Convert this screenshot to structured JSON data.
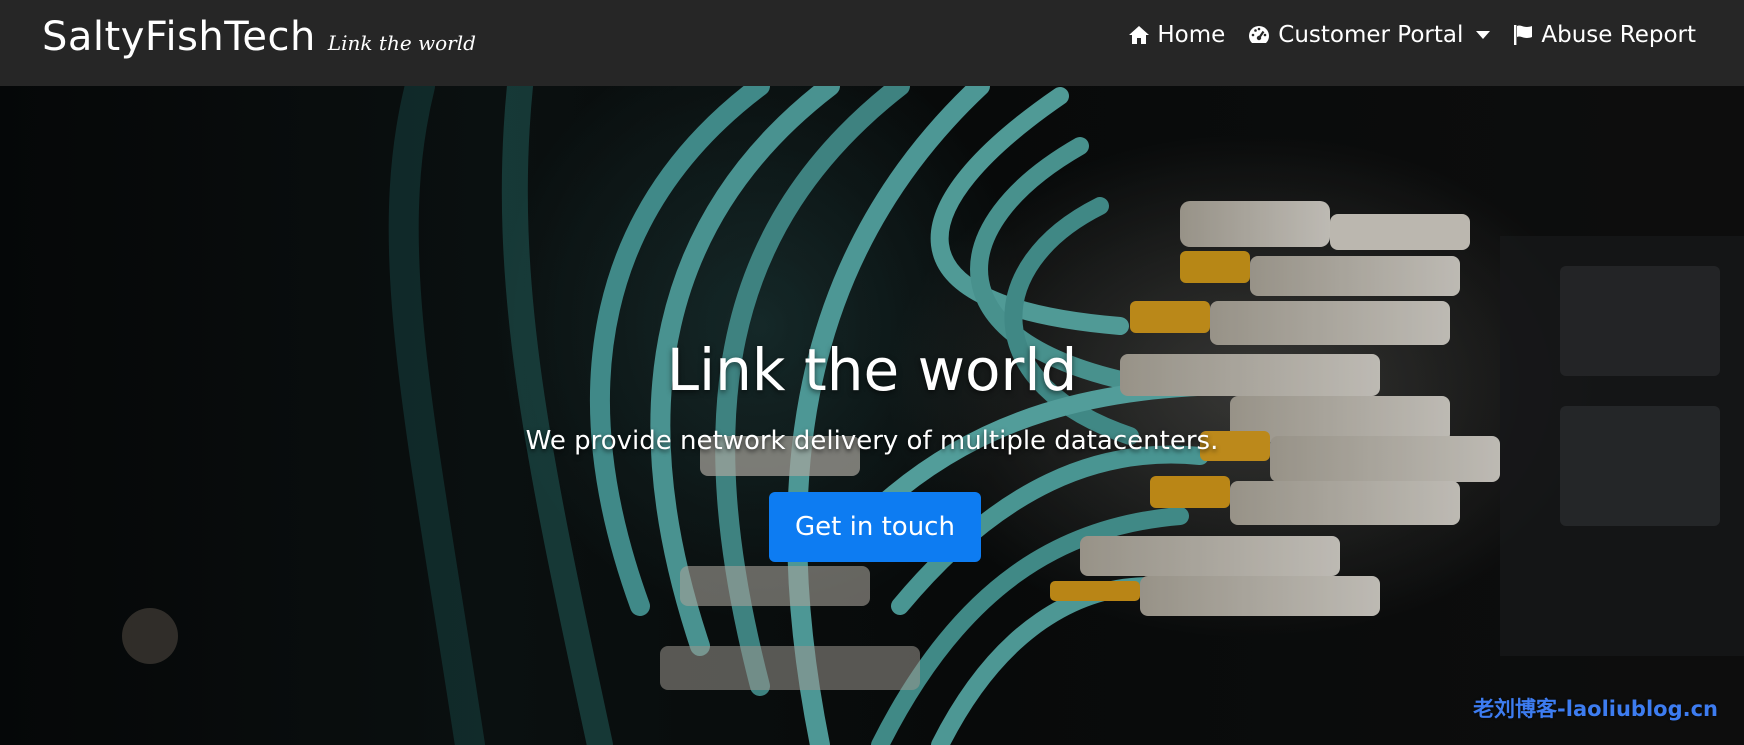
{
  "brand": {
    "name": "SaltyFishTech",
    "tagline": "Link the world"
  },
  "nav": {
    "home": "Home",
    "customer_portal": "Customer Portal",
    "abuse_report": "Abuse Report"
  },
  "hero": {
    "title": "Link the world",
    "subtitle": "We provide network delivery of multiple datacenters.",
    "cta": "Get in touch"
  },
  "watermark": "老刘博客-laoliublog.cn",
  "colors": {
    "navbar_bg": "#262626",
    "cta_bg": "#0d7cf2",
    "watermark": "#3d7cf0"
  }
}
